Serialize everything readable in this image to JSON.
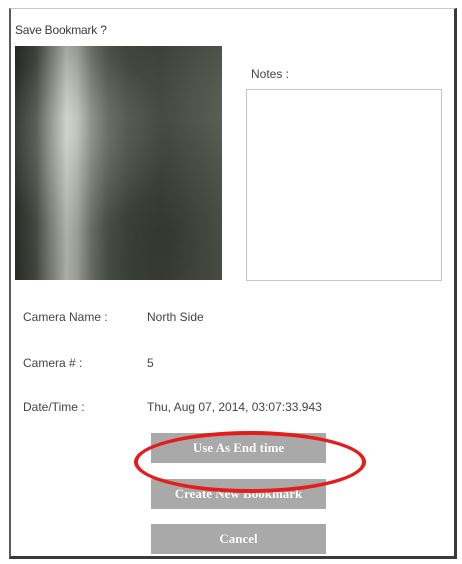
{
  "dialog": {
    "title": "Save Bookmark ?"
  },
  "notes": {
    "label": "Notes :",
    "value": ""
  },
  "fields": {
    "camera_name_label": "Camera Name :",
    "camera_name_value": "North Side",
    "camera_number_label": "Camera # :",
    "camera_number_value": "5",
    "datetime_label": "Date/Time :",
    "datetime_value": "Thu, Aug 07, 2014, 03:07:33.943"
  },
  "buttons": {
    "use_as_end_time": "Use As End time",
    "create_new_bookmark": "Create New Bookmark",
    "cancel": "Cancel"
  },
  "colors": {
    "button_bg": "#a9a9a9",
    "highlight": "#e51c1c"
  }
}
